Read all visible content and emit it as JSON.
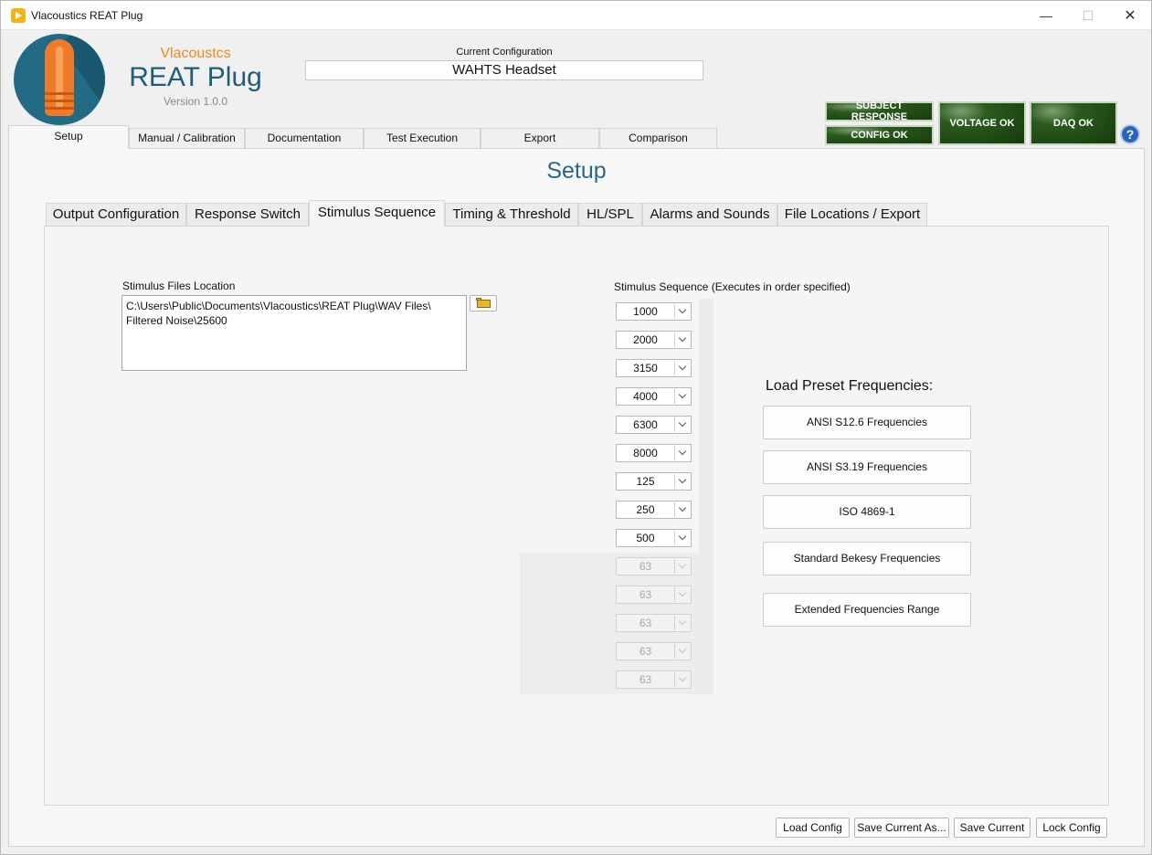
{
  "window": {
    "title": "Vlacoustics REAT Plug",
    "minimize": "—",
    "maximize": "☐",
    "close": "✕"
  },
  "header": {
    "brand_small": "Vlacoustcs",
    "brand_big": "REAT Plug",
    "version": "Version 1.0.0",
    "config_label": "Current Configuration",
    "config_value": "WAHTS Headset"
  },
  "status": {
    "subject_response": "SUBJECT RESPONSE",
    "config_ok": "CONFIG OK",
    "voltage_ok": "VOLTAGE OK",
    "daq_ok": "DAQ OK",
    "help": "?"
  },
  "main_tabs": [
    "Setup",
    "Manual / Calibration",
    "Documentation",
    "Test Execution",
    "Export",
    "Comparison"
  ],
  "section_title": "Setup",
  "sub_tabs": [
    "Output Configuration",
    "Response Switch",
    "Stimulus Sequence",
    "Timing & Threshold",
    "HL/SPL",
    "Alarms and Sounds",
    "File Locations / Export"
  ],
  "stimulus_files": {
    "label": "Stimulus Files Location",
    "path_line1": "C:\\Users\\Public\\Documents\\Vlacoustics\\REAT Plug\\WAV Files\\",
    "path_line2": "Filtered Noise\\25600"
  },
  "sequence": {
    "label": "Stimulus Sequence (Executes in order specified)",
    "items": [
      "1000",
      "2000",
      "3150",
      "4000",
      "6300",
      "8000",
      "125",
      "250",
      "500",
      "63",
      "63",
      "63",
      "63",
      "63"
    ],
    "enabled_count": 9
  },
  "presets": {
    "title": "Load Preset Frequencies:",
    "buttons": [
      "ANSI S12.6 Frequencies",
      "ANSI S3.19  Frequencies",
      "ISO 4869-1",
      "Standard Bekesy Frequencies",
      "Extended Frequencies Range"
    ]
  },
  "footer": {
    "load_config": "Load Config",
    "save_current_as": "Save Current As...",
    "save_current": "Save Current",
    "lock_config": "Lock Config"
  }
}
